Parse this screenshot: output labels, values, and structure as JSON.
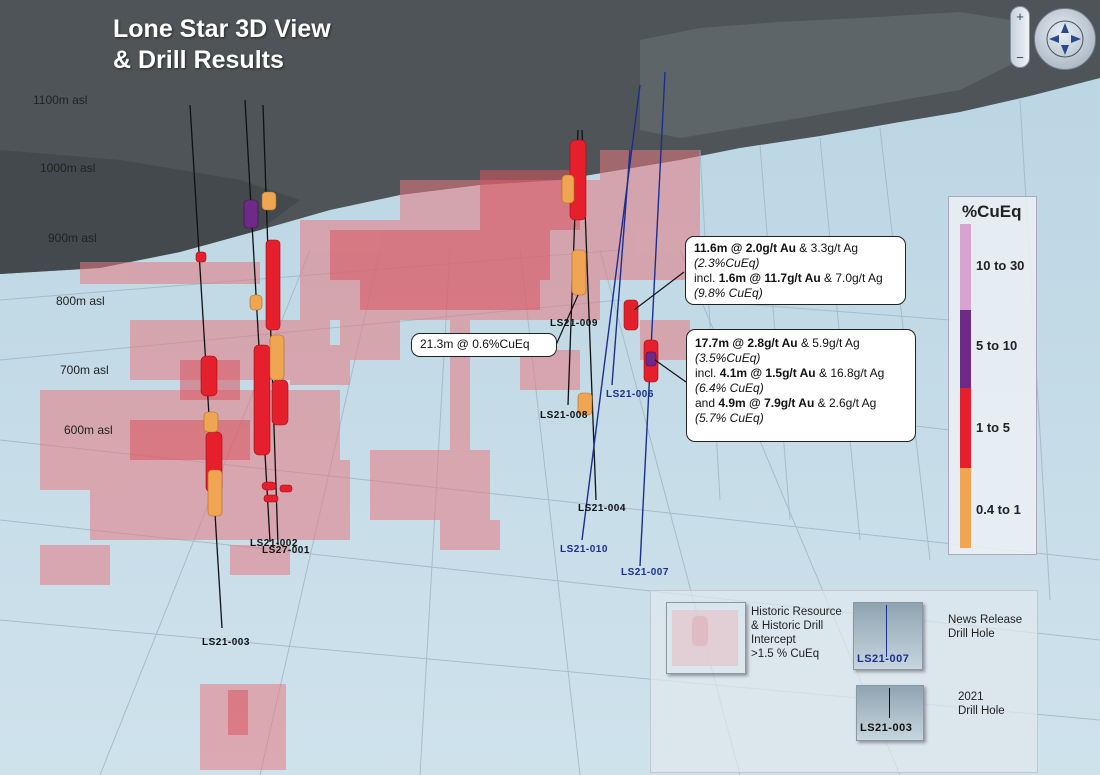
{
  "title": {
    "line1": "Lone Star 3D View",
    "line2": "& Drill Results"
  },
  "elevations": [
    "1100m asl",
    "1000m asl",
    "900m asl",
    "800m asl",
    "700m asl",
    "600m asl"
  ],
  "holes": {
    "ls21_003": "LS21-003",
    "ls21_002": "LS21-002",
    "ls21_001": "LS27-001",
    "ls21_009": "LS21-009",
    "ls21_008": "LS21-008",
    "ls21_004": "LS21-004",
    "ls21_010": "LS21-010",
    "ls21_006": "LS21-006",
    "ls21_007": "LS21-007"
  },
  "callouts": {
    "c1": {
      "l1_b": "11.6m @ 2.0g/t Au",
      "l1_r": " & 3.3g/t Ag",
      "l2": "(2.3%CuEq)",
      "l3_pre": "incl. ",
      "l3_b": "1.6m @ 11.7g/t Au",
      "l3_r": " & 7.0g/t Ag",
      "l4": "(9.8% CuEq)"
    },
    "c2": {
      "text": "21.3m @ 0.6%CuEq"
    },
    "c3": {
      "l1_b": "17.7m @ 2.8g/t Au",
      "l1_r": " & 5.9g/t Ag",
      "l2": "(3.5%CuEq)",
      "l3_pre": "incl. ",
      "l3_b": "4.1m @ 1.5g/t Au",
      "l3_r": " & 16.8g/t Ag",
      "l4": "(6.4% CuEq)",
      "l5_pre": "and ",
      "l5_b": "4.9m @ 7.9g/t Au",
      "l5_r": " & 2.6g/t Ag",
      "l6": "(5.7% CuEq)"
    }
  },
  "legend": {
    "title": "%CuEq",
    "items": [
      {
        "label": "10 to 30",
        "color": "#d9a3cf"
      },
      {
        "label": "5 to 10",
        "color": "#6e2a86"
      },
      {
        "label": "1 to 5",
        "color": "#e51f2b"
      },
      {
        "label": "0.4 to 1",
        "color": "#f0a553"
      }
    ]
  },
  "key": {
    "historic": [
      "Historic Resource",
      "& Historic Drill",
      "Intercept",
      ">1.5 % CuEq"
    ],
    "news": [
      "News Release",
      "Drill Hole"
    ],
    "news_thumb": "LS21-007",
    "drill2021": [
      "2021",
      "Drill Hole"
    ],
    "drill2021_thumb": "LS21-003"
  },
  "colors": {
    "resource": "#e57a82",
    "high": "#e51f2b",
    "low": "#f0a553",
    "mid": "#6e2a86",
    "news_hole": "#1a2f8f"
  },
  "controls": {
    "zoom_in": "+",
    "zoom_out": "−",
    "nav": "navigation-icon"
  }
}
